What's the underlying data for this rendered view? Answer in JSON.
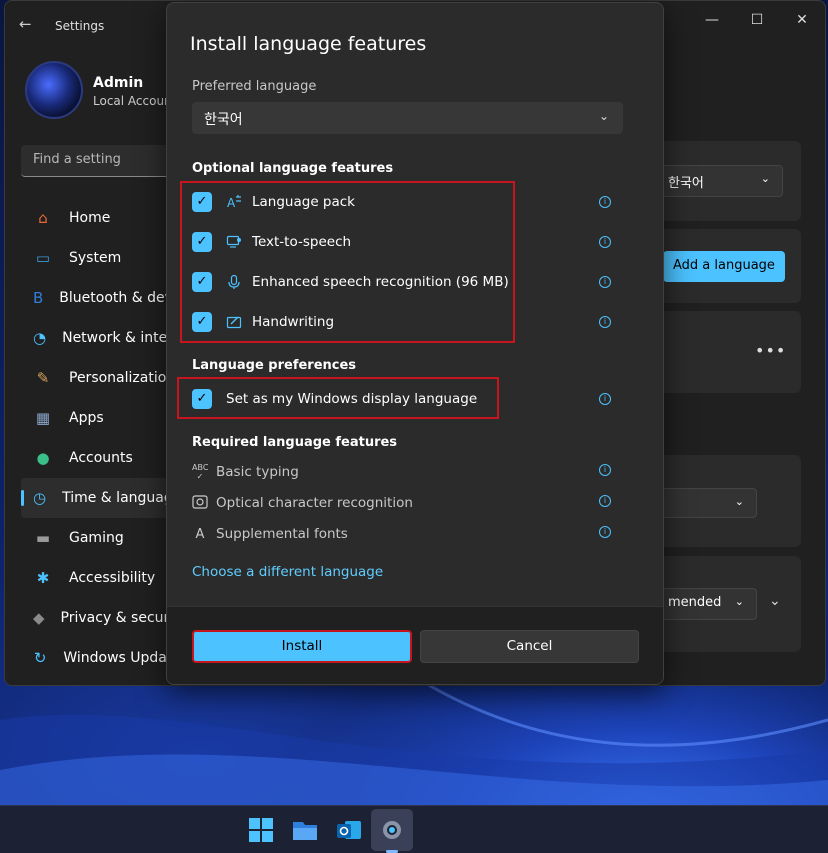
{
  "settings": {
    "app_title": "Settings",
    "user": {
      "name": "Admin",
      "account_type": "Local Account"
    },
    "search_placeholder": "Find a setting",
    "nav": [
      {
        "label": "Home",
        "icon": "home-icon",
        "color": "#e86a3a"
      },
      {
        "label": "System",
        "icon": "monitor-icon",
        "color": "#3a9ad9"
      },
      {
        "label": "Bluetooth & devices",
        "icon": "bluetooth-icon",
        "color": "#2f7fdc"
      },
      {
        "label": "Network & internet",
        "icon": "wifi-icon",
        "color": "#4cc2ff"
      },
      {
        "label": "Personalization",
        "icon": "brush-icon",
        "color": "#d9a35a"
      },
      {
        "label": "Apps",
        "icon": "apps-icon",
        "color": "#8aa4c8"
      },
      {
        "label": "Accounts",
        "icon": "person-icon",
        "color": "#3bbf8a"
      },
      {
        "label": "Time & language",
        "icon": "clock-globe-icon",
        "color": "#4cc2ff",
        "active": true
      },
      {
        "label": "Gaming",
        "icon": "gamepad-icon",
        "color": "#9a9a9a"
      },
      {
        "label": "Accessibility",
        "icon": "accessibility-icon",
        "color": "#4cc2ff"
      },
      {
        "label": "Privacy & security",
        "icon": "shield-icon",
        "color": "#8a8a8a"
      },
      {
        "label": "Windows Update",
        "icon": "update-icon",
        "color": "#4cc2ff"
      }
    ],
    "right": {
      "display_language_value": "한국어",
      "add_language_label": "Add a language",
      "recommended_partial": "mended"
    }
  },
  "dialog": {
    "title": "Install language features",
    "preferred_label": "Preferred language",
    "preferred_value": "한국어",
    "optional_header": "Optional language features",
    "optional": [
      {
        "label": "Language pack",
        "checked": true,
        "icon": "language-pack-icon"
      },
      {
        "label": "Text-to-speech",
        "checked": true,
        "icon": "text-to-speech-icon"
      },
      {
        "label": "Enhanced speech recognition (96 MB)",
        "checked": true,
        "icon": "microphone-icon"
      },
      {
        "label": "Handwriting",
        "checked": true,
        "icon": "handwriting-icon"
      }
    ],
    "prefs_header": "Language preferences",
    "display_pref_label": "Set as my Windows display language",
    "required_header": "Required language features",
    "required": [
      {
        "label": "Basic typing",
        "icon": "abc-check-icon"
      },
      {
        "label": "Optical character recognition",
        "icon": "ocr-icon"
      },
      {
        "label": "Supplemental fonts",
        "icon": "fonts-icon"
      }
    ],
    "link": "Choose a different language",
    "install_label": "Install",
    "cancel_label": "Cancel"
  },
  "colors": {
    "accent": "#4cc2ff",
    "highlight": "#c7151d"
  }
}
